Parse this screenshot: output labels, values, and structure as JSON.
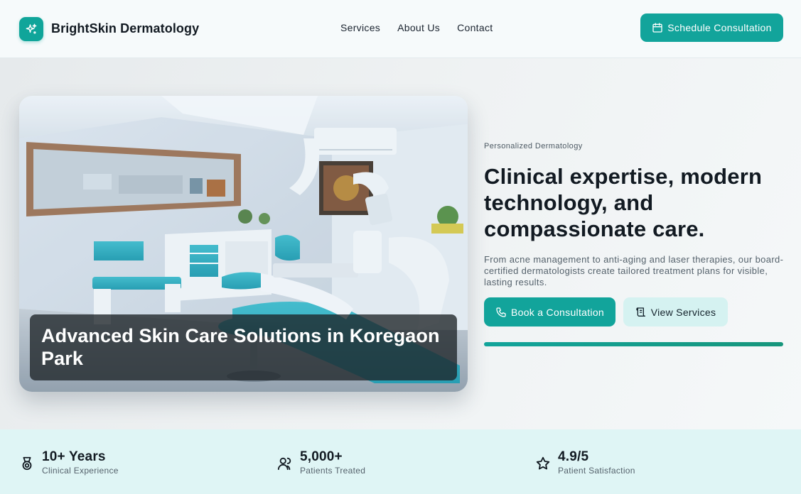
{
  "header": {
    "brand": "BrightSkin Dermatology",
    "logo_icon": "sparkles-icon",
    "nav": [
      "Services",
      "About Us",
      "Contact"
    ],
    "cta_label": "Schedule Consultation",
    "cta_icon": "calendar-icon"
  },
  "hero": {
    "image_caption": "Advanced Skin Care Solutions in Koregaon Park",
    "eyebrow": "Personalized Dermatology",
    "headline": "Clinical expertise, modern technology, and compassionate care.",
    "subtext": "From acne management to anti-aging and laser therapies, our board-certified dermatologists create tailored treatment plans for visible, lasting results.",
    "primary_cta": "Book a Consultation",
    "primary_icon": "phone-icon",
    "secondary_cta": "View Services",
    "secondary_icon": "scroll-icon"
  },
  "stats": [
    {
      "value": "10+ Years",
      "label": "Clinical Experience",
      "icon": "award-icon"
    },
    {
      "value": "5,000+",
      "label": "Patients Treated",
      "icon": "users-icon"
    },
    {
      "value": "4.9/5",
      "label": "Patient Satisfaction",
      "icon": "star-icon"
    }
  ],
  "colors": {
    "accent": "#12a49b",
    "accent_light": "#d5f2f1",
    "stats_bg": "#dff5f5"
  }
}
